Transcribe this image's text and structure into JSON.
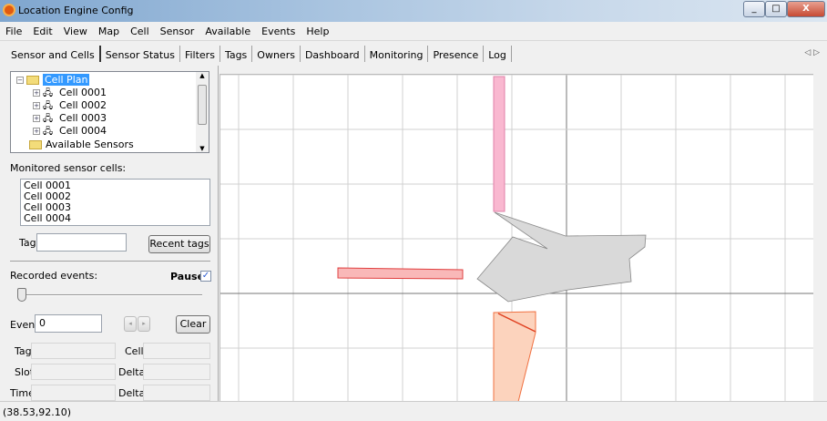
{
  "window": {
    "title": "Location Engine Config",
    "min": "_",
    "max": "□",
    "close": "X"
  },
  "menu": [
    "File",
    "Edit",
    "View",
    "Map",
    "Cell",
    "Sensor",
    "Available",
    "Events",
    "Help"
  ],
  "tabs": [
    "Sensor and Cells",
    "Sensor Status",
    "Filters",
    "Tags",
    "Owners",
    "Dashboard",
    "Monitoring",
    "Presence",
    "Log"
  ],
  "tree": {
    "root": "Cell Plan",
    "cells": [
      "Cell 0001",
      "Cell 0002",
      "Cell 0003",
      "Cell 0004"
    ],
    "available": "Available Sensors"
  },
  "monitored": {
    "label": "Monitored sensor cells:",
    "items": [
      "Cell 0001",
      "Cell 0002",
      "Cell 0003",
      "Cell 0004"
    ]
  },
  "tag": {
    "label": "Tag",
    "value": "",
    "recent_button": "Recent tags"
  },
  "recorded": {
    "label": "Recorded events:",
    "pause_label": "Pause",
    "pause_checked": true,
    "slider_value": 0
  },
  "event": {
    "label": "Event",
    "value": "0",
    "clear_button": "Clear"
  },
  "fields": {
    "tag": "Tag",
    "cell": "Cell",
    "slot": "Slot",
    "delta1": "Delta",
    "time": "Time",
    "delta2": "Delta"
  },
  "status": {
    "coords": "(38.53,92.10)"
  },
  "colors": {
    "pink": "#f9b8d0",
    "gray": "#d9d9d9",
    "red": "#f9b8b8",
    "orange": "#fcd3bd"
  }
}
